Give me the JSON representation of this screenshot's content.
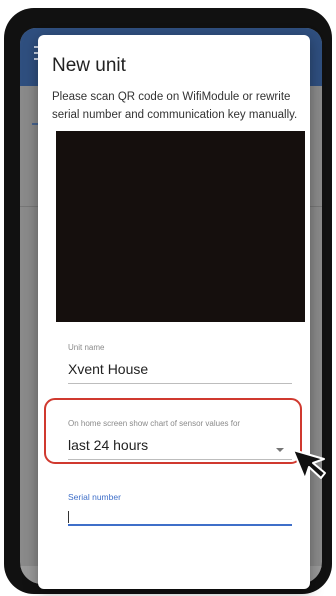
{
  "dialog": {
    "title": "New unit",
    "description": "Please scan QR code on WifiModule or rewrite serial number and communication key manually."
  },
  "unit_name": {
    "label": "Unit name",
    "value": "Xvent House"
  },
  "chart_setting": {
    "label": "On home screen show chart of sensor values for",
    "selected": "last 24 hours"
  },
  "serial_number": {
    "label": "Serial number",
    "value": ""
  },
  "colors": {
    "app_bar": "#2f4f7f",
    "accent": "#3f6fc9",
    "highlight": "#d0392f"
  },
  "icons": {
    "menu": "menu-icon",
    "dropdown": "chevron-down-icon",
    "pointer": "cursor-icon"
  }
}
